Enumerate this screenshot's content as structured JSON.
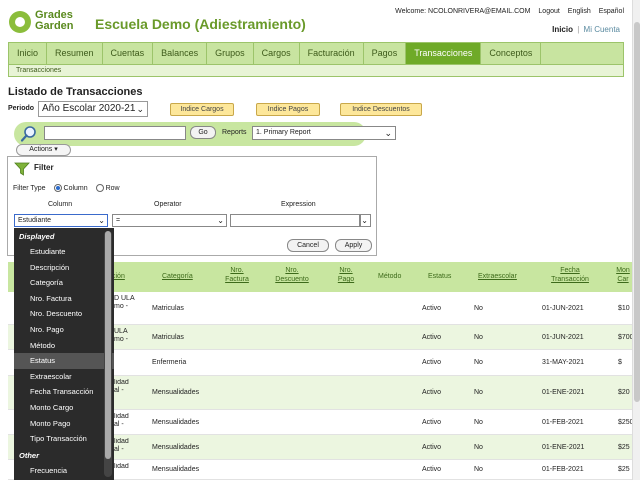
{
  "header": {
    "logo_line1": "Grades",
    "logo_line2": "Garden",
    "school_name": "Escuela Demo (Adiestramiento)",
    "welcome": "Welcome: NCOLONRIVERA@EMAIL.COM",
    "logout": "Logout",
    "english": "English",
    "espanol": "Español",
    "inicio": "Inicio",
    "sep": "|",
    "mi_cuenta": "Mi Cuenta"
  },
  "menu": {
    "items": [
      "Inicio",
      "Resumen",
      "Cuentas",
      "Balances",
      "Grupos",
      "Cargos",
      "Facturación",
      "Pagos",
      "Transacciones",
      "Conceptos"
    ],
    "active_index": 8,
    "sub_item": "Transacciones"
  },
  "page": {
    "title": "Listado de Transacciones",
    "period_label": "Periodo",
    "period_value": "Año Escolar 2020-21",
    "indices": [
      "Indice Cargos",
      "Indice Pagos",
      "Indice Descuentos"
    ]
  },
  "search": {
    "go_label": "Go",
    "reports_label": "Reports",
    "reports_value": "1. Primary Report",
    "actions_label": "Actions"
  },
  "filter": {
    "title": "Filter",
    "filter_type_label": "Filter Type",
    "radio_column": "Column",
    "radio_row": "Row",
    "column_head": "Column",
    "operator_head": "Operator",
    "expression_head": "Expression",
    "column_value": "Estudiante",
    "operator_value": "=",
    "cancel_label": "Cancel",
    "apply_label": "Apply"
  },
  "dropdown": {
    "displayed_label": "Displayed",
    "displayed": [
      "Estudiante",
      "Descripción",
      "Categoría",
      "Nro. Factura",
      "Nro. Descuento",
      "Nro. Pago",
      "Método",
      "Estatus",
      "Extraescolar",
      "Fecha Transacción",
      "Monto Cargo",
      "Monto Pago",
      "Tipo Transacción"
    ],
    "highlighted_index": 7,
    "other_label": "Other",
    "other": [
      "Frecuencia"
    ]
  },
  "table": {
    "headers": {
      "descripcion": "ción",
      "categoria": "Categoría",
      "nro_factura": "Nro. Factura",
      "nro_descuento": "Nro. Descuento",
      "nro_pago": "Nro. Pago",
      "metodo": "Método",
      "estatus": "Estatus",
      "extraescolar": "Extraescolar",
      "fecha": "Fecha Transacción",
      "monto": "Mon Car"
    },
    "rows": [
      {
        "desc": "D ULA mo -",
        "categoria": "Matriculas",
        "estatus": "Activo",
        "extra": "No",
        "fecha": "01-JUN-2021",
        "monto": "$10"
      },
      {
        "desc": "ULA mo -",
        "categoria": "Matriculas",
        "estatus": "Activo",
        "extra": "No",
        "fecha": "01-JUN-2021",
        "monto": "$700"
      },
      {
        "desc": "",
        "categoria": "Enfermeria",
        "estatus": "Activo",
        "extra": "No",
        "fecha": "31-MAY-2021",
        "monto": "$"
      },
      {
        "desc": "lidad al -",
        "categoria": "Mensualidades",
        "estatus": "Activo",
        "extra": "No",
        "fecha": "01-ENE-2021",
        "monto": "$20"
      },
      {
        "desc": "lidad al -",
        "categoria": "Mensualidades",
        "estatus": "Activo",
        "extra": "No",
        "fecha": "01-FEB-2021",
        "monto": "$250"
      },
      {
        "desc": "lidad al -",
        "categoria": "Mensualidades",
        "estatus": "Activo",
        "extra": "No",
        "fecha": "01-ENE-2021",
        "monto": "$25"
      },
      {
        "desc": "lidad",
        "categoria": "Mensualidades",
        "estatus": "Activo",
        "extra": "No",
        "fecha": "01-FEB-2021",
        "monto": "$25"
      }
    ]
  }
}
